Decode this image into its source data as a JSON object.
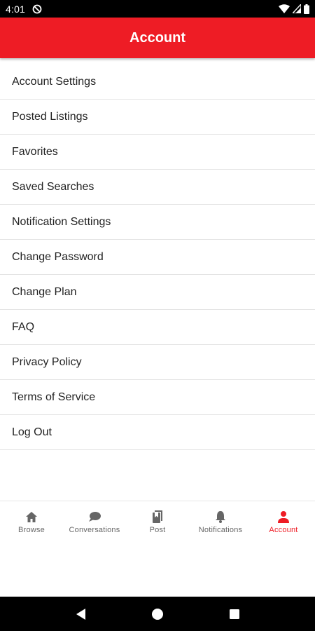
{
  "status_bar": {
    "time": "4:01",
    "icons": [
      "do-not-disturb-icon",
      "wifi-icon",
      "signal-icon",
      "battery-icon"
    ]
  },
  "app_bar": {
    "title": "Account",
    "color": "#ee1c25"
  },
  "menu": {
    "items": [
      {
        "label": "Account Settings"
      },
      {
        "label": "Posted Listings"
      },
      {
        "label": "Favorites"
      },
      {
        "label": "Saved Searches"
      },
      {
        "label": "Notification Settings"
      },
      {
        "label": "Change Password"
      },
      {
        "label": "Change Plan"
      },
      {
        "label": "FAQ"
      },
      {
        "label": "Privacy Policy"
      },
      {
        "label": "Terms of Service"
      },
      {
        "label": "Log Out"
      }
    ]
  },
  "bottom_nav": {
    "items": [
      {
        "label": "Browse",
        "icon": "home-icon",
        "active": false
      },
      {
        "label": "Conversations",
        "icon": "chat-bubble-icon",
        "active": false
      },
      {
        "label": "Post",
        "icon": "post-icon",
        "active": false
      },
      {
        "label": "Notifications",
        "icon": "bell-icon",
        "active": false
      },
      {
        "label": "Account",
        "icon": "person-icon",
        "active": true
      }
    ],
    "active_color": "#ee1c25",
    "inactive_color": "#666666"
  },
  "system_nav": {
    "buttons": [
      "back-icon",
      "home-circle-icon",
      "recents-icon"
    ]
  }
}
